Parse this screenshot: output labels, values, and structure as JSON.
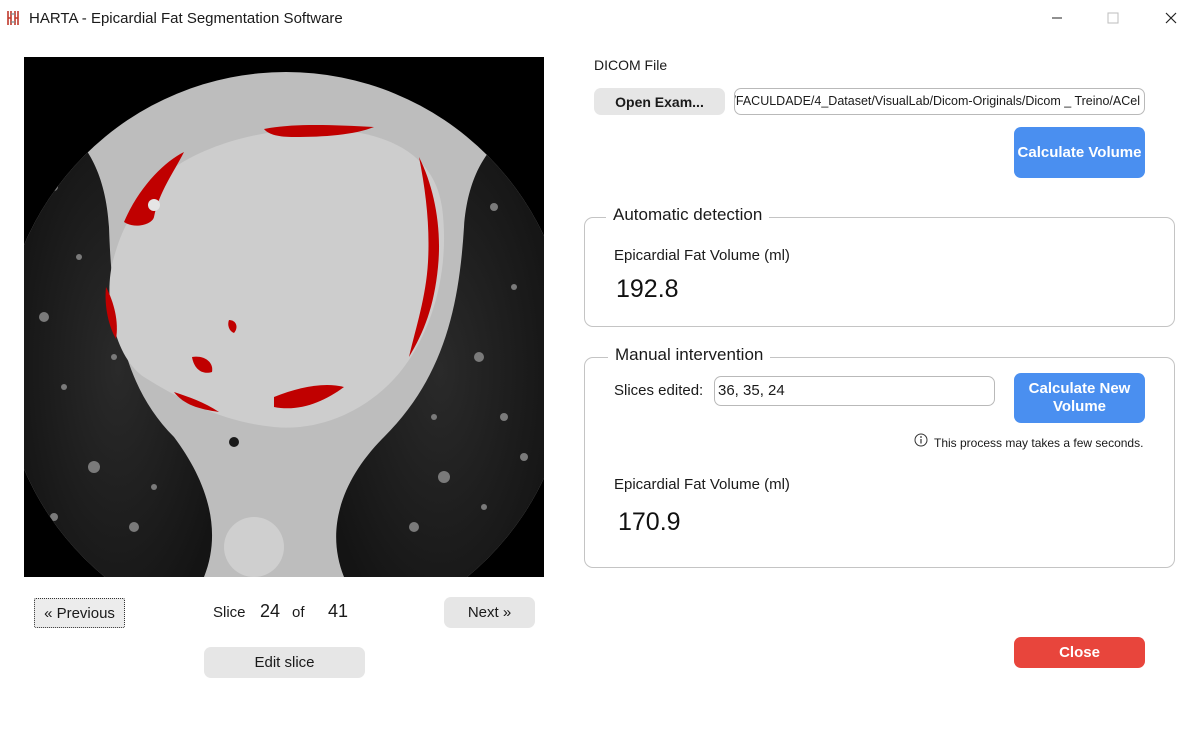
{
  "window": {
    "title": "HARTA - Epicardial Fat Segmentation Software",
    "icons": [
      "app-logo-icon",
      "minimize-icon",
      "maximize-icon",
      "close-window-icon"
    ]
  },
  "viewer": {
    "prev_label": "« Previous",
    "next_label": "Next »",
    "slice_label": "Slice",
    "of_label": "of",
    "current_slice": "24",
    "total_slices": "41",
    "edit_label": "Edit slice",
    "segmentation_color": "#c00000"
  },
  "dicom": {
    "label": "DICOM File",
    "open_label": "Open Exam...",
    "path": "/FACULDADE/4_Dataset/VisualLab/Dicom-Originals/Dicom _ Treino/ACel",
    "calc_label": "Calculate Volume"
  },
  "automatic": {
    "title": "Automatic detection",
    "volume_label": "Epicardial Fat Volume (ml)",
    "volume_value": "192.8"
  },
  "manual": {
    "title": "Manual intervention",
    "slices_label": "Slices edited:",
    "slices_value": "36, 35, 24",
    "calc_new_label": "Calculate New Volume",
    "note": "This process may takes a few seconds.",
    "volume_label": "Epicardial Fat Volume (ml)",
    "volume_value": "170.9"
  },
  "footer": {
    "close_label": "Close"
  },
  "colors": {
    "accent": "#4a8ff0",
    "danger": "#e8453c",
    "button_gray": "#e6e6e6"
  }
}
